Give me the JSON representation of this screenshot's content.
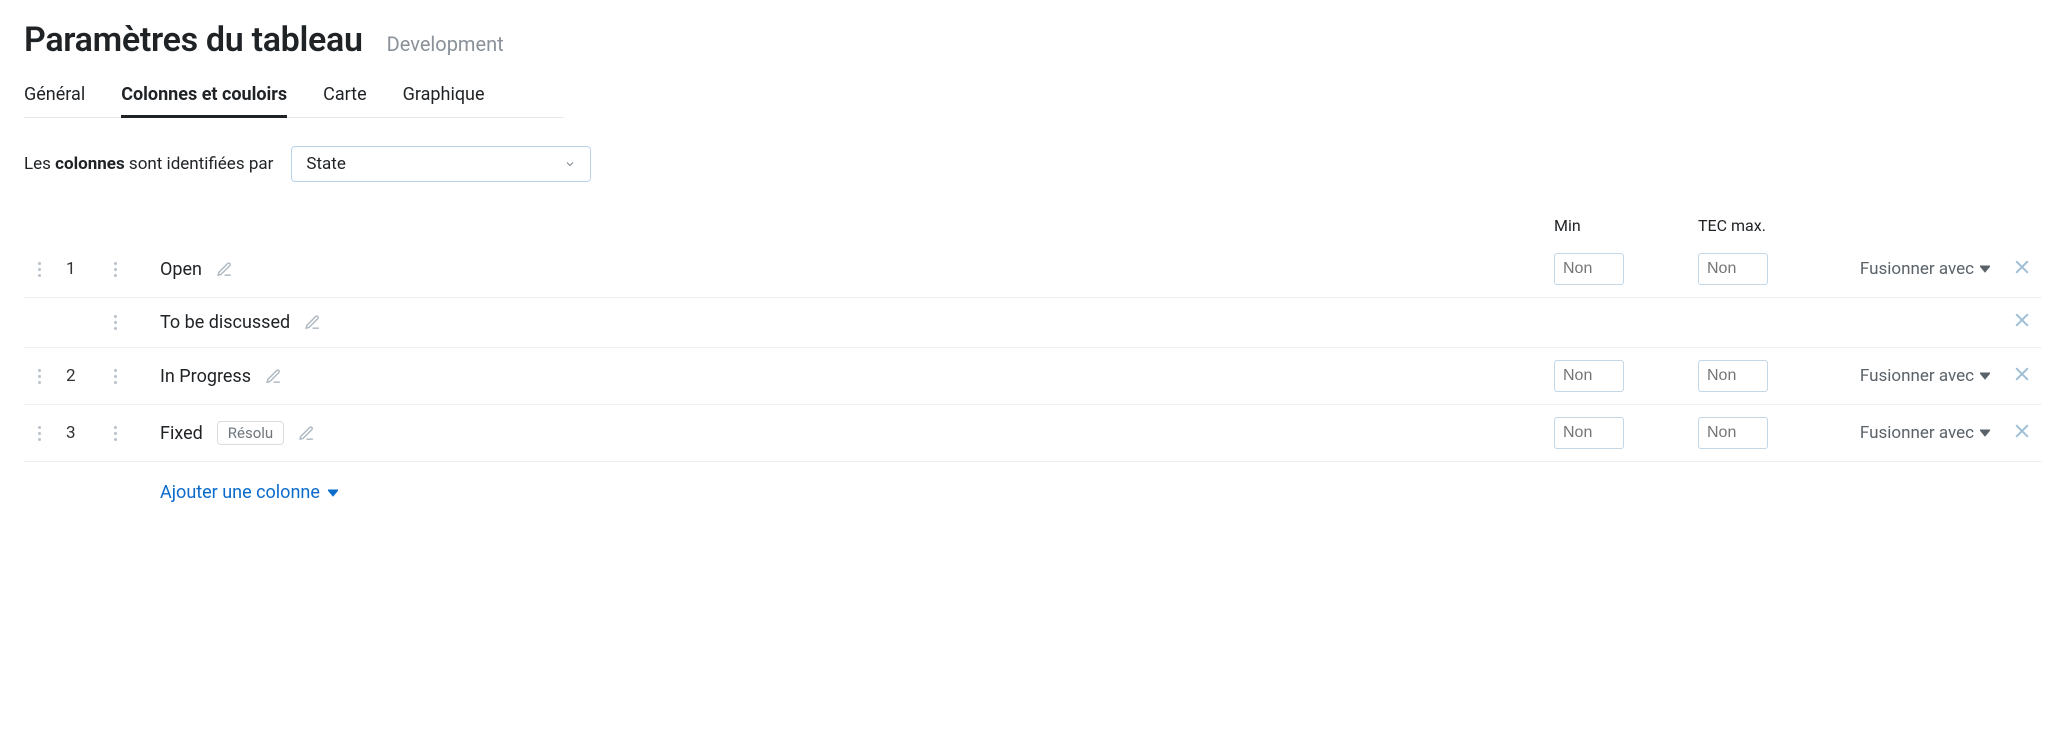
{
  "header": {
    "title": "Paramètres du tableau",
    "subtitle": "Development"
  },
  "tabs": {
    "items": [
      {
        "label": "Général",
        "active": false
      },
      {
        "label": "Colonnes et couloirs",
        "active": true
      },
      {
        "label": "Carte",
        "active": false
      },
      {
        "label": "Graphique",
        "active": false
      }
    ]
  },
  "identifier": {
    "prefix": "Les ",
    "bold": "colonnes",
    "suffix": " sont identifiées par",
    "select_value": "State"
  },
  "headers": {
    "min": "Min",
    "tec": "TEC max."
  },
  "placeholders": {
    "non": "Non"
  },
  "merge_label": "Fusionner avec",
  "rows": [
    {
      "num": "1",
      "name": "Open",
      "badge": null,
      "has_inputs": true,
      "sub": {
        "name": "To be discussed"
      }
    },
    {
      "num": "2",
      "name": "In Progress",
      "badge": null,
      "has_inputs": true,
      "sub": null
    },
    {
      "num": "3",
      "name": "Fixed",
      "badge": "Résolu",
      "has_inputs": true,
      "sub": null
    }
  ],
  "add_column": "Ajouter une colonne"
}
